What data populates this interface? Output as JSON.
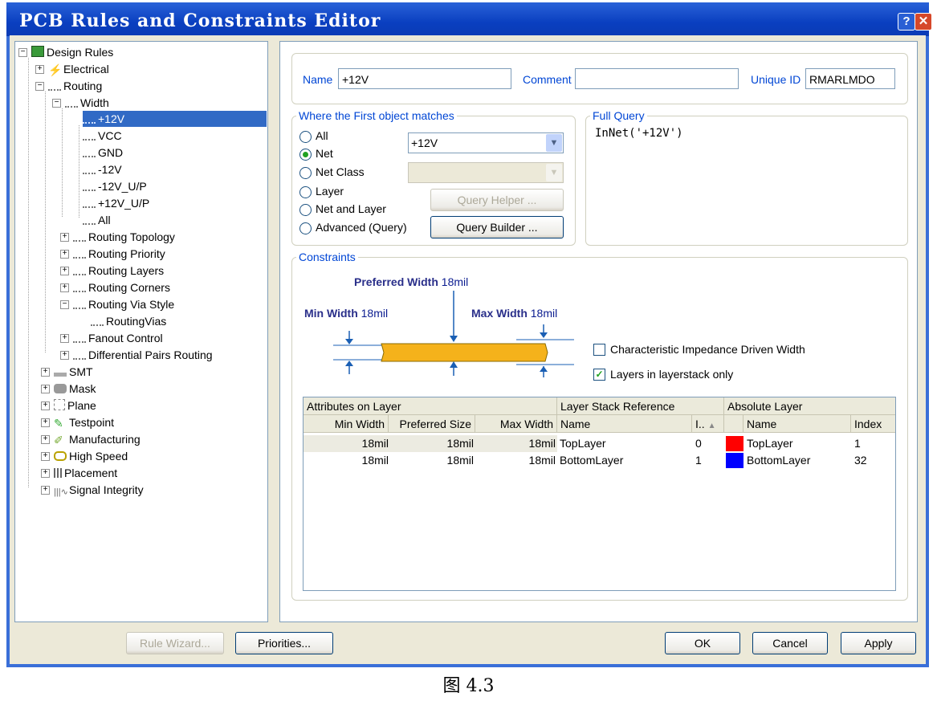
{
  "window": {
    "title": "PCB Rules and Constraints Editor"
  },
  "tree": {
    "root": "Design Rules",
    "nodes": [
      "Electrical",
      "Routing",
      "Width",
      "+12V",
      "VCC",
      "GND",
      "-12V",
      "-12V_U/P",
      "+12V_U/P",
      "All",
      "Routing Topology",
      "Routing Priority",
      "Routing Layers",
      "Routing Corners",
      "Routing Via Style",
      "RoutingVias",
      "Fanout Control",
      "Differential Pairs Routing",
      "SMT",
      "Mask",
      "Plane",
      "Testpoint",
      "Manufacturing",
      "High Speed",
      "Placement",
      "Signal Integrity"
    ],
    "selected": "+12V"
  },
  "rule": {
    "name_label": "Name",
    "name_value": "+12V",
    "comment_label": "Comment",
    "comment_value": "",
    "uid_label": "Unique ID",
    "uid_value": "RMARLMDO"
  },
  "where": {
    "title": "Where the First object matches",
    "options": [
      "All",
      "Net",
      "Net Class",
      "Layer",
      "Net and Layer",
      "Advanced (Query)"
    ],
    "selected": "Net",
    "net_value": "+12V",
    "query_helper": "Query Helper ...",
    "query_builder": "Query Builder ..."
  },
  "full_query": {
    "title": "Full Query",
    "text": "InNet('+12V')"
  },
  "constraints": {
    "title": "Constraints",
    "preferred_label": "Preferred Width",
    "preferred_value": "18mil",
    "min_label": "Min Width",
    "min_value": "18mil",
    "max_label": "Max Width",
    "max_value": "18mil",
    "impedance_label": "Characteristic Impedance Driven Width",
    "impedance_checked": false,
    "layerstack_label": "Layers in layerstack only",
    "layerstack_checked": true
  },
  "table": {
    "group_headers": [
      "Attributes on Layer",
      "Layer Stack Reference",
      "Absolute Layer"
    ],
    "columns": [
      "Min Width",
      "Preferred Size",
      "Max Width",
      "Name",
      "I..",
      "Name",
      "Index"
    ],
    "rows": [
      {
        "min": "18mil",
        "pref": "18mil",
        "max": "18mil",
        "name": "TopLayer",
        "idx": "0",
        "color": "#ff0000",
        "abs_name": "TopLayer",
        "abs_index": "1"
      },
      {
        "min": "18mil",
        "pref": "18mil",
        "max": "18mil",
        "name": "BottomLayer",
        "idx": "1",
        "color": "#0000ff",
        "abs_name": "BottomLayer",
        "abs_index": "32"
      }
    ]
  },
  "footer": {
    "rule_wizard": "Rule Wizard...",
    "priorities": "Priorities...",
    "ok": "OK",
    "cancel": "Cancel",
    "apply": "Apply"
  },
  "caption": "图 4.3"
}
